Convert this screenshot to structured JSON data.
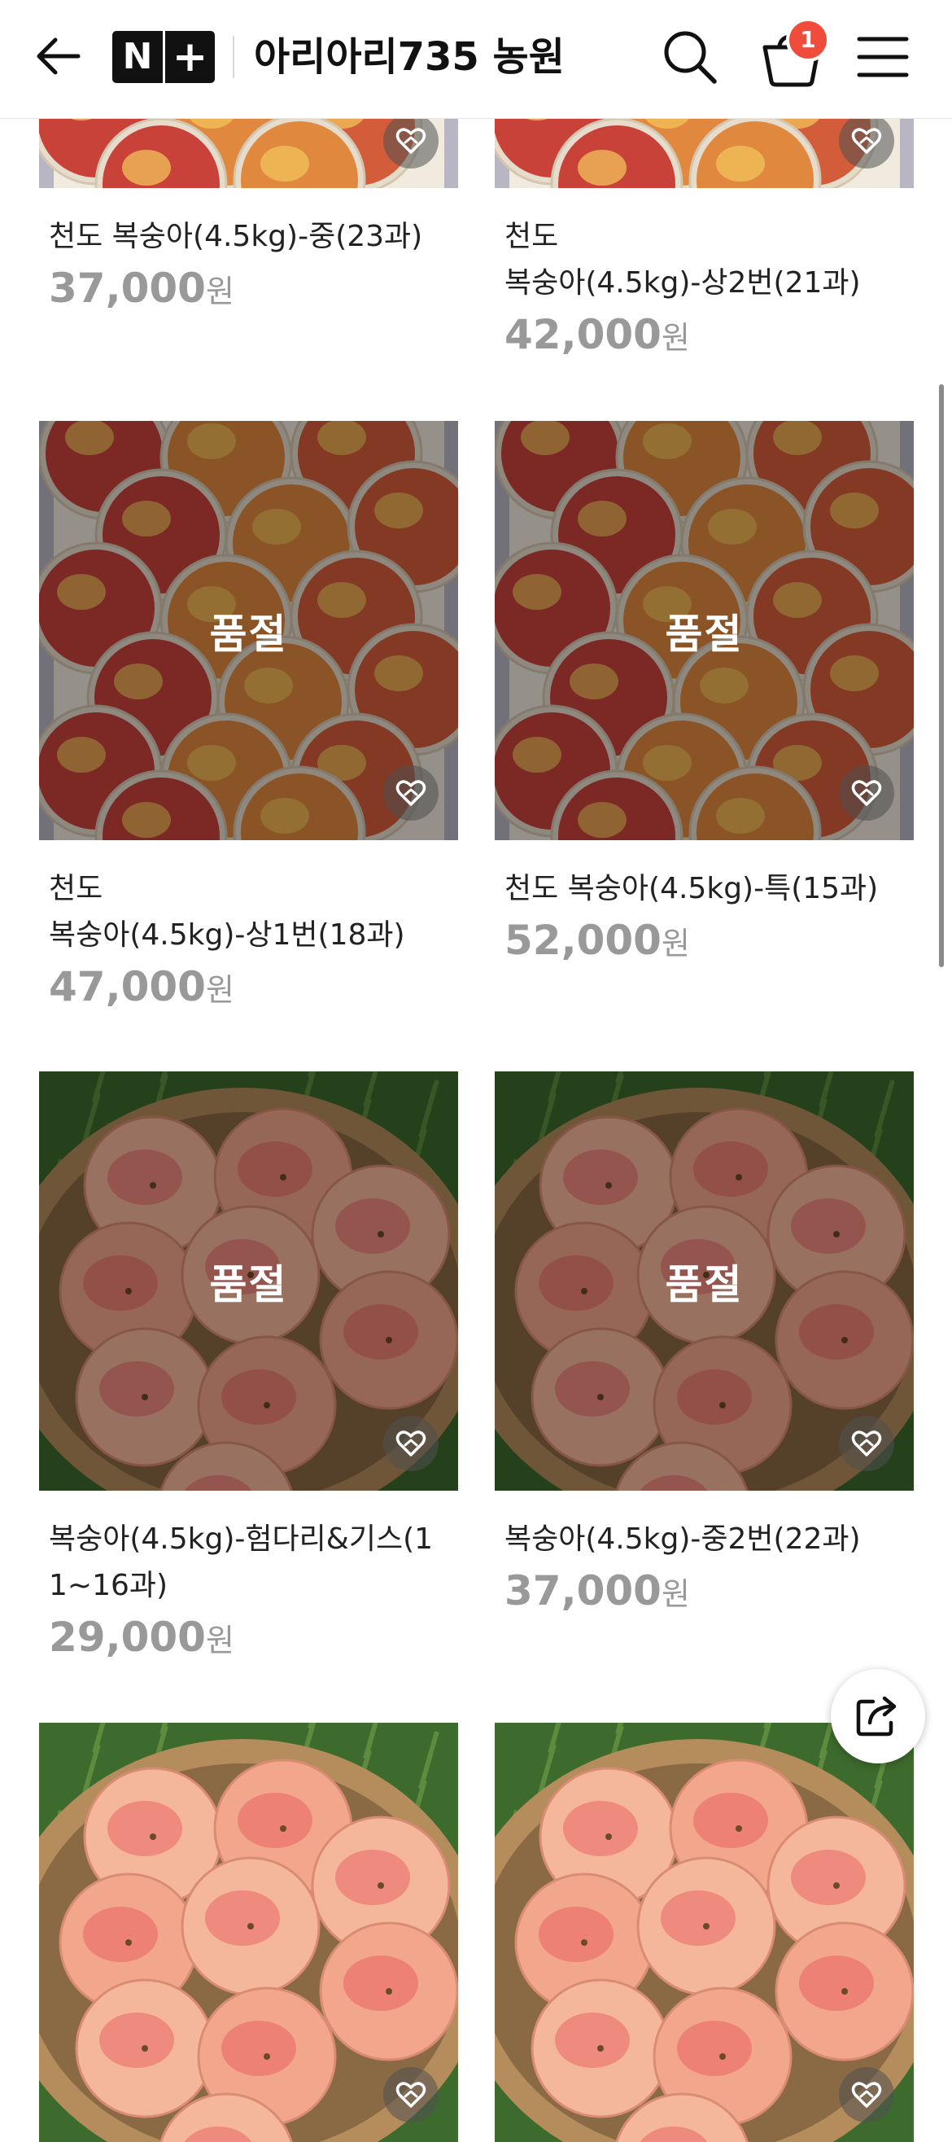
{
  "header": {
    "back_icon": "arrow-left-icon",
    "logo_n": "N",
    "logo_plus": "+",
    "store_title": "아리아리735 농원",
    "search_icon": "search-icon",
    "cart_icon": "shopping-bag-icon",
    "cart_count": "1",
    "cart_badge_color": "#f04c3c",
    "menu_icon": "hamburger-menu-icon"
  },
  "products": [
    {
      "name_lines": [
        "천도 복숭아(4.5kg)-중(23과)"
      ],
      "price": "37,000",
      "currency": "원",
      "sold_out": false,
      "sold_out_label": "",
      "photo": "peach-box"
    },
    {
      "name_lines": [
        "천도",
        "복숭아(4.5kg)-상2번(21과)"
      ],
      "price": "42,000",
      "currency": "원",
      "sold_out": false,
      "sold_out_label": "",
      "photo": "peach-box"
    },
    {
      "name_lines": [
        "천도",
        "복숭아(4.5kg)-상1번(18과)"
      ],
      "price": "47,000",
      "currency": "원",
      "sold_out": true,
      "sold_out_label": "품절",
      "photo": "peach-box"
    },
    {
      "name_lines": [
        "천도 복숭아(4.5kg)-특(15과)"
      ],
      "price": "52,000",
      "currency": "원",
      "sold_out": true,
      "sold_out_label": "품절",
      "photo": "peach-box"
    },
    {
      "name_lines": [
        "복숭아(4.5kg)-험다리&기스(1",
        "1~16과)"
      ],
      "price": "29,000",
      "currency": "원",
      "sold_out": true,
      "sold_out_label": "품절",
      "photo": "peach-basket"
    },
    {
      "name_lines": [
        "복숭아(4.5kg)-중2번(22과)"
      ],
      "price": "37,000",
      "currency": "원",
      "sold_out": true,
      "sold_out_label": "품절",
      "photo": "peach-basket"
    },
    {
      "name_lines": [],
      "price": "",
      "currency": "",
      "sold_out": false,
      "sold_out_label": "",
      "photo": "peach-basket"
    },
    {
      "name_lines": [],
      "price": "",
      "currency": "",
      "sold_out": false,
      "sold_out_label": "",
      "photo": "peach-basket"
    }
  ],
  "wishlist_icon": "heart-icon",
  "share_icon": "share-icon",
  "price_color": "#999999"
}
